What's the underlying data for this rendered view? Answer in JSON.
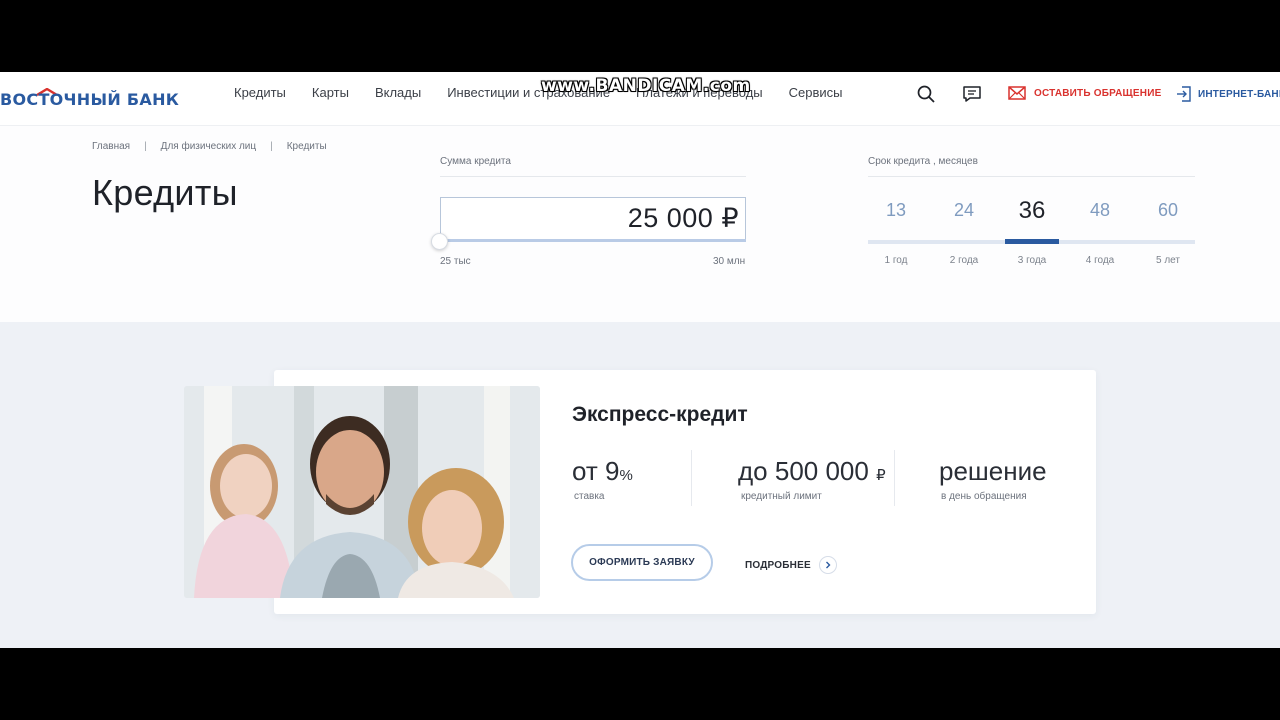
{
  "watermark": "www.BANDICAM.com",
  "header": {
    "logo": "ВОСТОЧНЫЙ БАНК",
    "nav": [
      "Кредиты",
      "Карты",
      "Вклады",
      "Инвестиции и страхование",
      "Платежи и переводы",
      "Сервисы"
    ],
    "appeal_label": "ОСТАВИТЬ ОБРАЩЕНИЕ",
    "internet_bank_label": "ИНТЕРНЕТ-БАНК"
  },
  "breadcrumb": [
    "Главная",
    "Для физических лиц",
    "Кредиты"
  ],
  "page_title": "Кредиты",
  "amount": {
    "label": "Сумма кредита",
    "value": "25 000 ₽",
    "min_label": "25 тыс",
    "max_label": "30 млн",
    "slider_fraction": 0.0
  },
  "term": {
    "label": "Срок кредита , месяцев",
    "options": [
      {
        "months": "13",
        "years": "1 год"
      },
      {
        "months": "24",
        "years": "2 года"
      },
      {
        "months": "36",
        "years": "3 года"
      },
      {
        "months": "48",
        "years": "4 года"
      },
      {
        "months": "60",
        "years": "5 лет"
      }
    ],
    "selected": "36"
  },
  "product": {
    "title": "Экспресс-кредит",
    "rate_prefix": "от 9",
    "rate_unit": "%",
    "rate_caption": "ставка",
    "limit_prefix": "до 500 000",
    "limit_unit": "₽",
    "limit_caption": "кредитный лимит",
    "decision": "решение",
    "decision_caption": "в день обращения",
    "apply_label": "ОФОРМИТЬ ЗАЯВКУ",
    "more_label": "ПОДРОБНЕЕ"
  },
  "colors": {
    "brand_blue": "#2a5aa0",
    "brand_red": "#d9322e",
    "section_bg": "#eef1f6"
  }
}
